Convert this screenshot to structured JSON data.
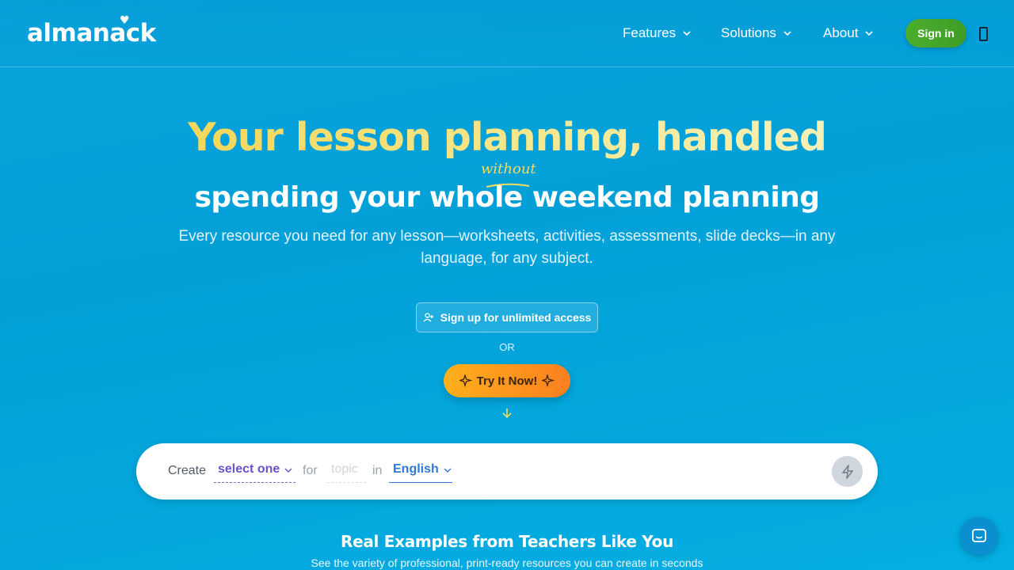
{
  "header": {
    "logo": "almanack",
    "nav": [
      {
        "label": "Features"
      },
      {
        "label": "Solutions"
      },
      {
        "label": "About"
      }
    ],
    "signin_label": "Sign in"
  },
  "hero": {
    "title": "Your lesson planning, handled",
    "without": "without",
    "subtitle": "spending your whole weekend planning",
    "description": "Every resource you need for any lesson—worksheets, activities, assessments, slide decks—in any language, for any subject.",
    "signup_label": "Sign up for unlimited access",
    "or": "OR",
    "try_label": "Try It Now!"
  },
  "creator": {
    "create": "Create",
    "select_value": "select one",
    "for": "for",
    "topic_placeholder": "topic",
    "in": "in",
    "language_value": "English"
  },
  "examples": {
    "title": "Real Examples from Teachers Like You",
    "subtitle": "See the variety of professional, print-ready resources you can create in seconds"
  },
  "colors": {
    "accent_yellow": "#f4d75a",
    "signin_green": "#4cae2e",
    "try_orange": "#fb7f1f",
    "select_purple": "#6a52c9",
    "language_blue": "#2f7ad6"
  }
}
